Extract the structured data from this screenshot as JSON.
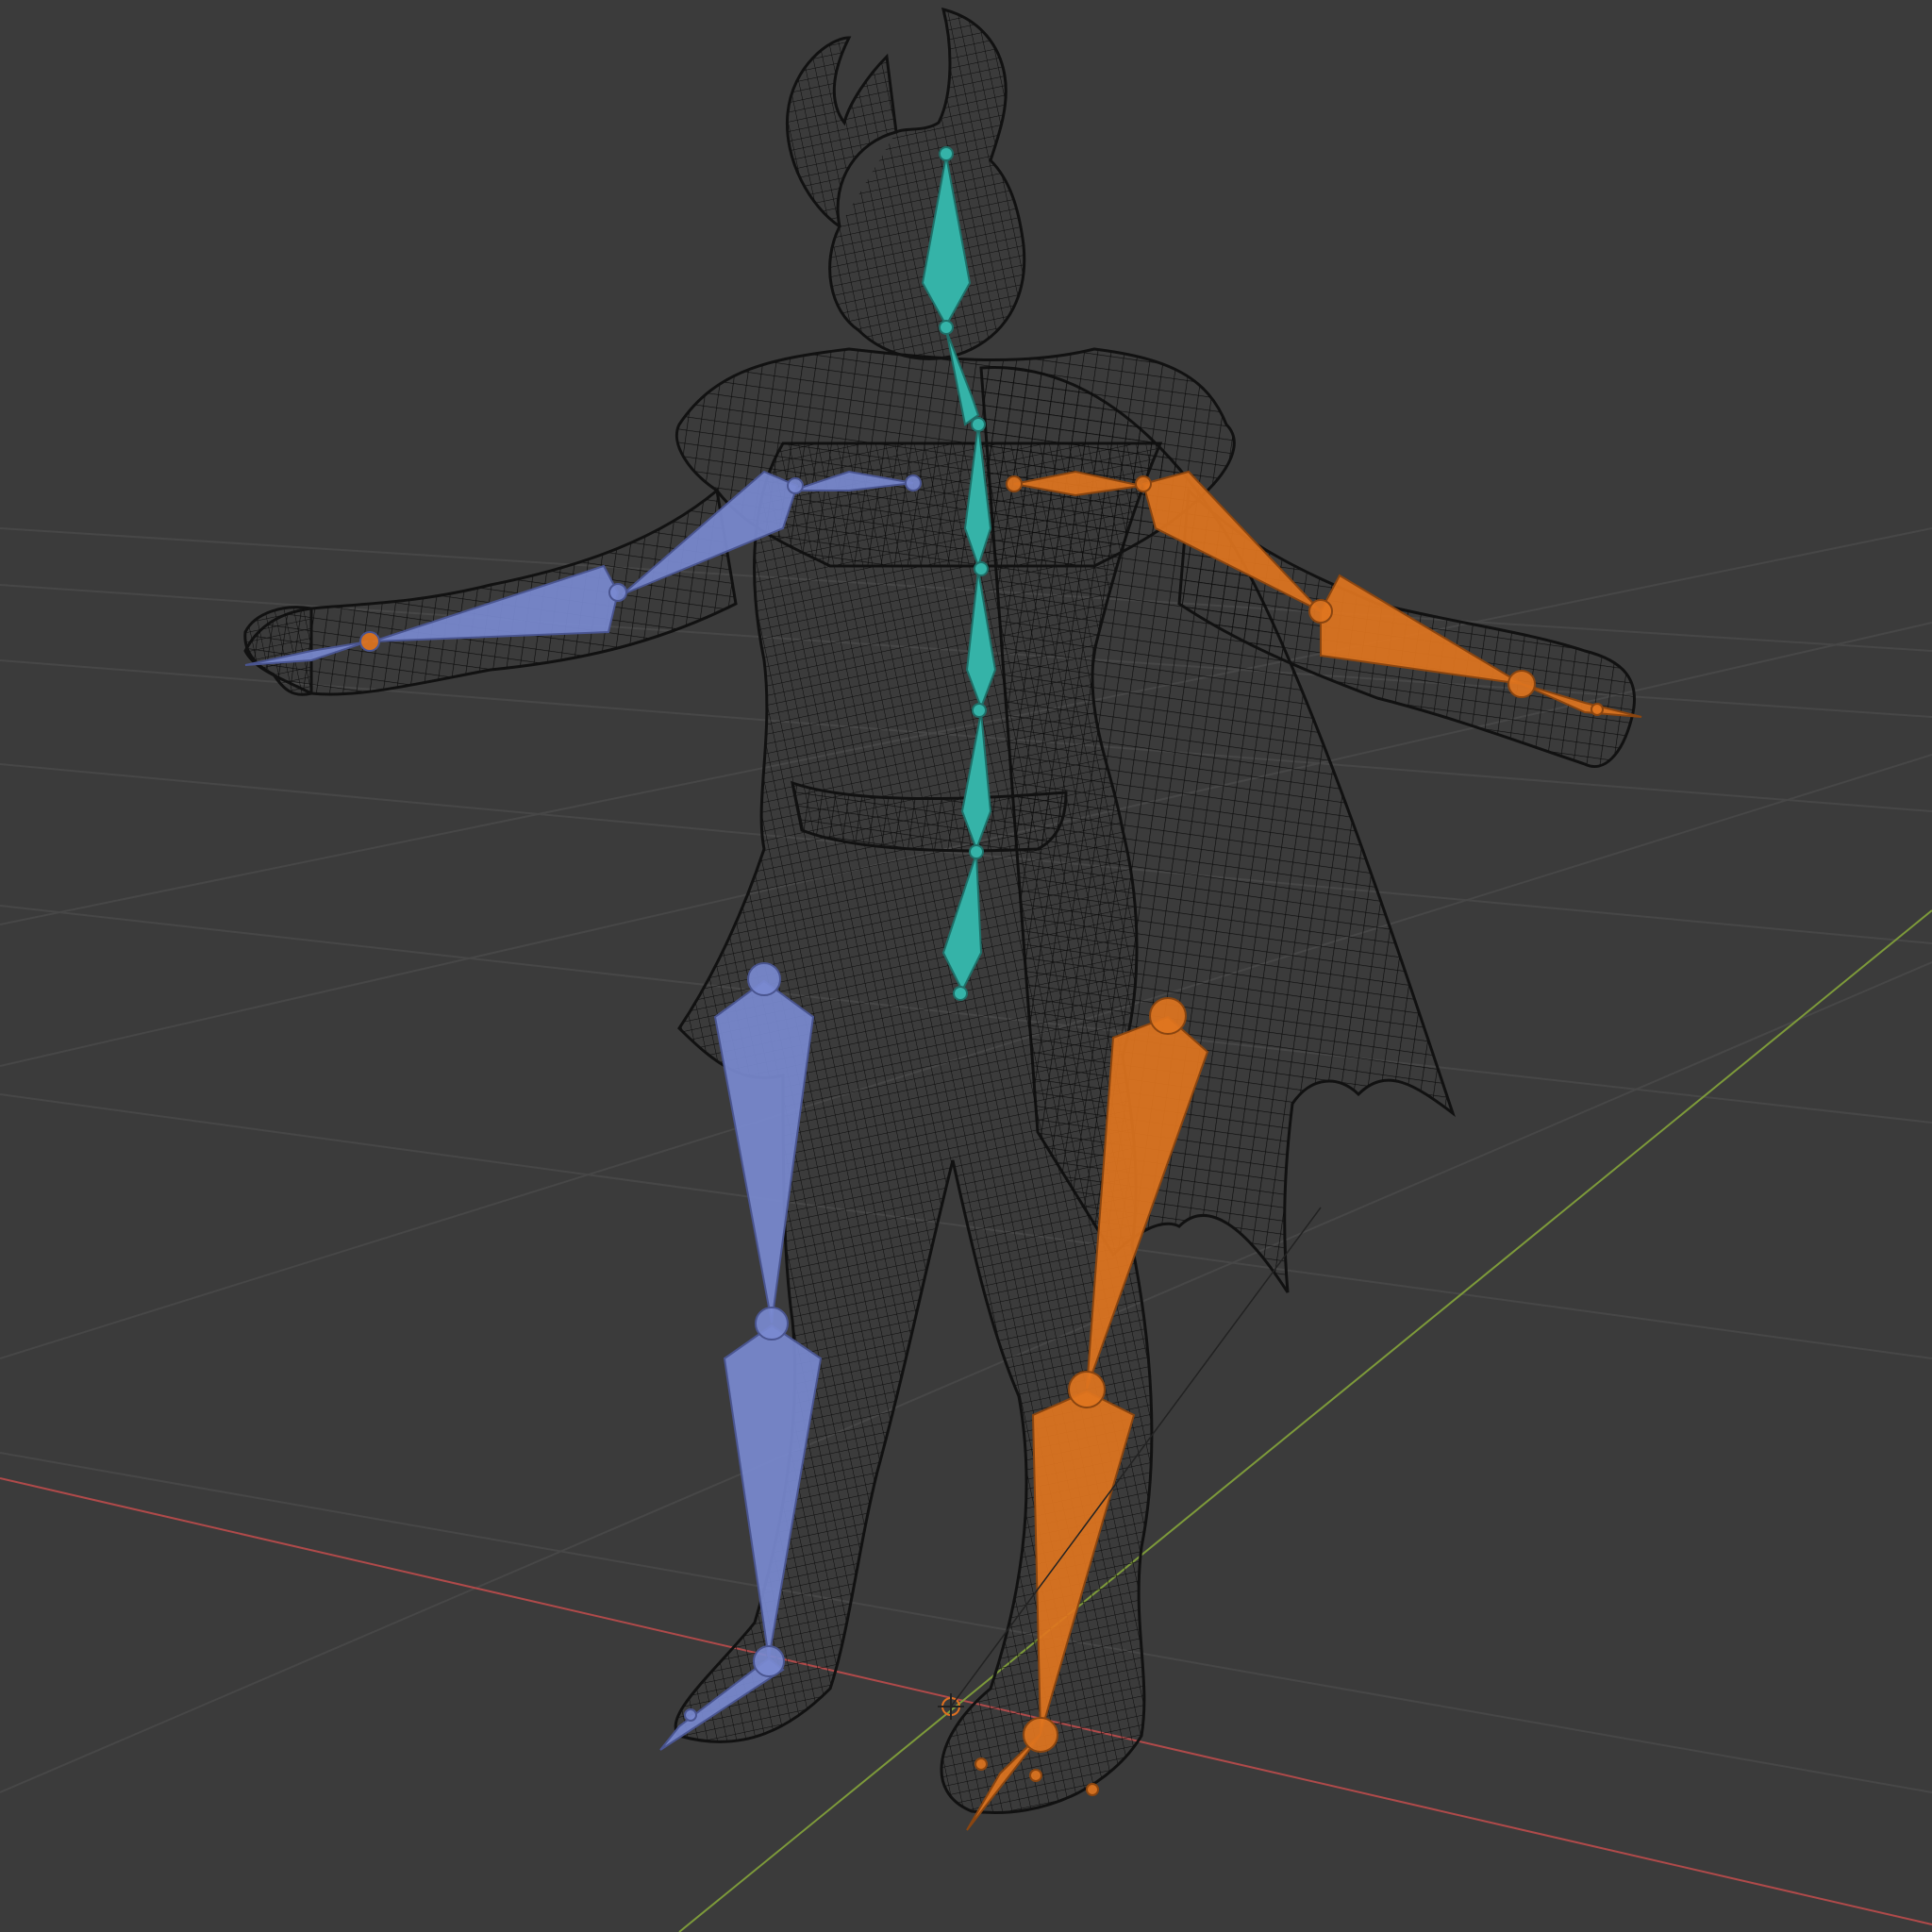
{
  "viewport": {
    "label": "",
    "colors": {
      "background": "#3b3b3b",
      "grid": "#474747",
      "x_axis": "#b04a4a",
      "y_axis": "#7d9a3a",
      "mesh": "#0c0c0c",
      "bones_left": "#7a8ad0",
      "bones_right": "#e0751f",
      "bones_center": "#35b3a8",
      "origin": "#e07020"
    },
    "armature": {
      "bone_groups": [
        "spine",
        "left-arm",
        "right-arm",
        "left-leg",
        "right-leg"
      ]
    }
  }
}
